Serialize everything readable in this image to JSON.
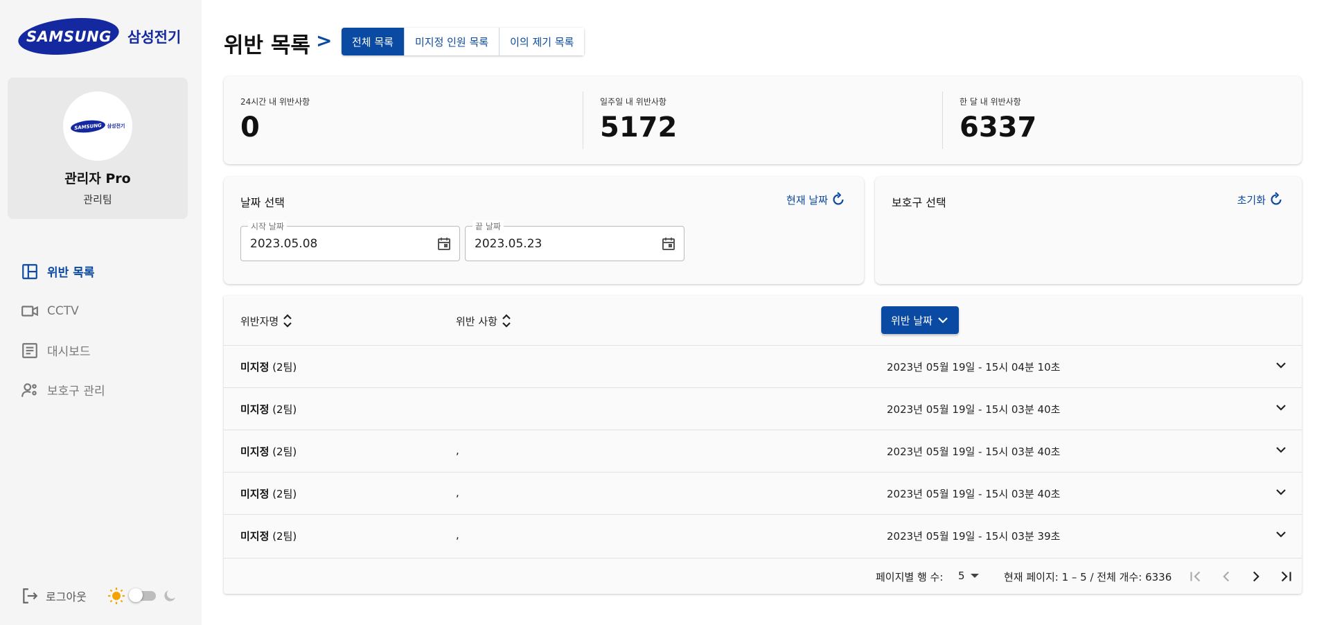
{
  "brand": {
    "logo_text": "SAMSUNG",
    "name_kr": "삼성전기"
  },
  "profile": {
    "avatar_logo": "SAMSUNG",
    "avatar_kr": "삼성전기",
    "name": "관리자 Pro",
    "team": "관리팀"
  },
  "nav": [
    {
      "label": "위반 목록",
      "icon": "dashboard-layout-icon",
      "active": true
    },
    {
      "label": "CCTV",
      "icon": "video-camera-icon",
      "active": false
    },
    {
      "label": "대시보드",
      "icon": "document-icon",
      "active": false
    },
    {
      "label": "보호구 관리",
      "icon": "user-settings-icon",
      "active": false
    }
  ],
  "logout_label": "로그아웃",
  "header": {
    "title": "위반 목록",
    "separator": ">",
    "tabs": [
      "전체 목록",
      "미지정 인원 목록",
      "이의 제기 목록"
    ],
    "active_tab": 0
  },
  "stats": [
    {
      "label": "24시간 내 위반사항",
      "value": "0"
    },
    {
      "label": "일주일 내 위반사항",
      "value": "5172"
    },
    {
      "label": "한 달 내 위반사항",
      "value": "6337"
    }
  ],
  "date_card": {
    "title": "날짜 선택",
    "action": "현재 날짜",
    "start_label": "시작 날짜",
    "start_value": "2023.05.08",
    "end_label": "끝 날짜",
    "end_value": "2023.05.23"
  },
  "guard_card": {
    "title": "보호구 선택",
    "action": "초기화"
  },
  "table": {
    "headers": {
      "name": "위반자명",
      "violation": "위반 사항",
      "date": "위반 날짜"
    },
    "rows": [
      {
        "name": "미지정",
        "team": "(2팀)",
        "violation": "",
        "date": "2023년 05월 19일 - 15시 04분 10초"
      },
      {
        "name": "미지정",
        "team": "(2팀)",
        "violation": "",
        "date": "2023년 05월 19일 - 15시 03분 40초"
      },
      {
        "name": "미지정",
        "team": "(2팀)",
        "violation": ",",
        "date": "2023년 05월 19일 - 15시 03분 40초"
      },
      {
        "name": "미지정",
        "team": "(2팀)",
        "violation": ",",
        "date": "2023년 05월 19일 - 15시 03분 40초"
      },
      {
        "name": "미지정",
        "team": "(2팀)",
        "violation": ",",
        "date": "2023년 05월 19일 - 15시 03분 39초"
      }
    ]
  },
  "pagination": {
    "rows_label": "페이지별 행 수:",
    "rows_value": "5",
    "info": "현재 페이지: 1 – 5 / 전체 개수: 6336"
  },
  "colors": {
    "primary": "#0b4aa2",
    "brand": "#1428a0",
    "sun": "#f4a300"
  }
}
